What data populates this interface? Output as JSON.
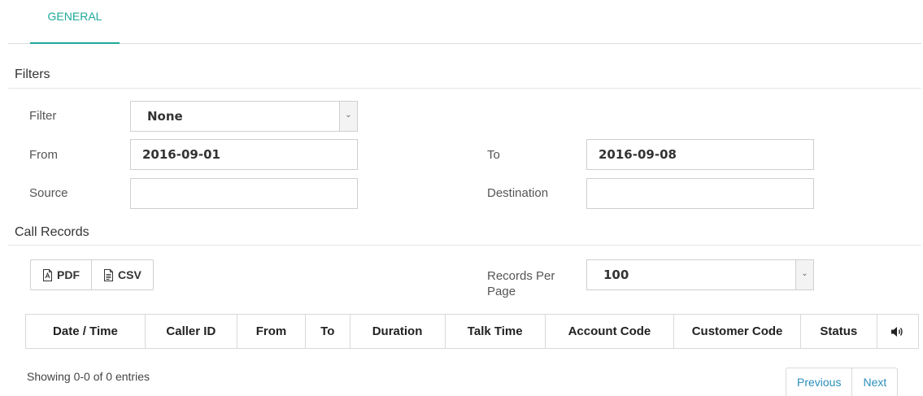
{
  "tabs": [
    {
      "label": "GENERAL"
    }
  ],
  "filters": {
    "title": "Filters",
    "filter_label": "Filter",
    "filter_value": "None",
    "from_label": "From",
    "from_value": "2016-09-01",
    "to_label": "To",
    "to_value": "2016-09-08",
    "source_label": "Source",
    "source_value": "",
    "destination_label": "Destination",
    "destination_value": ""
  },
  "records": {
    "title": "Call Records",
    "pdf_label": "PDF",
    "csv_label": "CSV",
    "per_page_label_line1": "Records Per",
    "per_page_label_line2": "Page",
    "per_page_value": "100",
    "columns": [
      "Date / Time",
      "Caller ID",
      "From",
      "To",
      "Duration",
      "Talk Time",
      "Account Code",
      "Customer Code",
      "Status"
    ],
    "audio_column_icon": "speaker-icon",
    "rows": [],
    "info": "Showing 0-0 of 0 entries",
    "previous_label": "Previous",
    "next_label": "Next"
  },
  "colors": {
    "accent": "#1fa99a",
    "link": "#2a8fbd"
  }
}
